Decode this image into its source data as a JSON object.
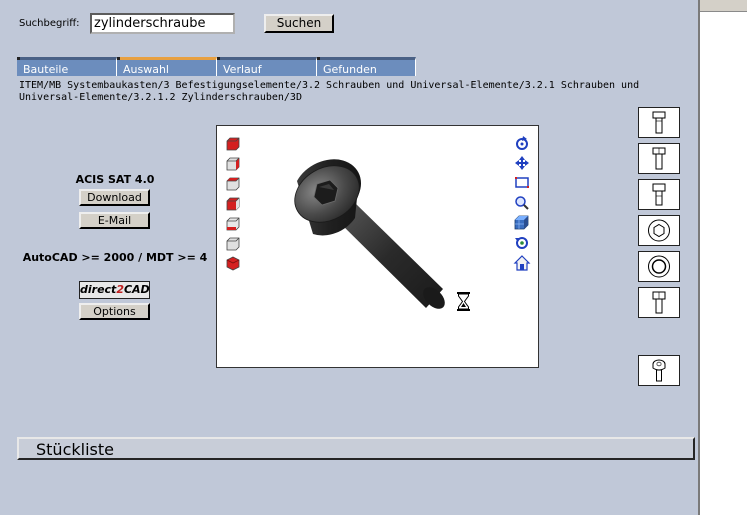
{
  "search": {
    "label": "Suchbegriff:",
    "value": "zylinderschraube",
    "button": "Suchen"
  },
  "tabs": [
    {
      "label": "Bauteile",
      "active": false
    },
    {
      "label": "Auswahl",
      "active": true
    },
    {
      "label": "Verlauf",
      "active": false
    },
    {
      "label": "Gefunden",
      "active": false
    }
  ],
  "breadcrumb": "ITEM/MB Systembaukasten/3 Befestigungselemente/3.2 Schrauben und Universal-Elemente/3.2.1 Schrauben und Universal-Elemente/3.2.1.2 Zylinderschrauben/3D",
  "formats": {
    "format1": {
      "title": "ACIS SAT 4.0",
      "download": "Download",
      "email": "E-Mail"
    },
    "format2": {
      "title": "AutoCAD >= 2000 / MDT >= 4",
      "logo_text_a": "direct",
      "logo_text_b": "2",
      "logo_text_c": "CAD",
      "options": "Options"
    }
  },
  "viewer": {
    "left_icons": [
      "view-front-icon",
      "view-back-icon",
      "view-left-icon",
      "view-right-icon",
      "view-top-icon",
      "view-bottom-icon",
      "view-iso-icon"
    ],
    "right_icons": [
      "rotate-icon",
      "pan-icon",
      "zoom-window-icon",
      "zoom-icon",
      "shading-icon",
      "reset-rotation-icon",
      "home-icon"
    ],
    "part_color": "#2d2d2d",
    "accent_red": "#d42020",
    "accent_blue": "#2040c0"
  },
  "bom": {
    "title": "Stückliste"
  }
}
